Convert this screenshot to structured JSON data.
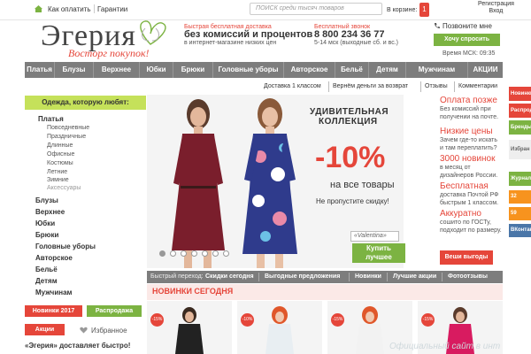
{
  "topbar": {
    "how_to_pay": "Как оплатить",
    "guarantee": "Гарантии",
    "search_placeholder": "ПОИСК среди тысяч товаров",
    "cart_label": "В корзине:",
    "cart_count": "1",
    "register": "Регистрация",
    "login": "Вход"
  },
  "header": {
    "logo": "Эгерия",
    "slogan": "Восторг покупок!",
    "delivery_line1": "Быстрая бесплатная доставка",
    "delivery_line2": "без комиссий и процентов",
    "delivery_line3": "в интернет-магазине низких цен",
    "call_line1": "Бесплатный звонок",
    "phone": "8 800 234 36 77",
    "hours": "5-14 мск (выходные сб. и вс.)",
    "call_me": "Позвоните мне",
    "ask_button": "Хочу спросить",
    "msk_time": "Время МСК: 09:35"
  },
  "nav": {
    "items": [
      "Платья",
      "Блузы",
      "Верхнее",
      "Юбки",
      "Брюки",
      "Головные уборы",
      "Авторское",
      "Бельё",
      "Детям",
      "Мужчинам",
      "АКЦИИ"
    ]
  },
  "subnav": {
    "items": [
      "Доставка 1 классом",
      "Вернём деньги за возврат",
      "Отзывы",
      "Комментарии"
    ]
  },
  "sidebar": {
    "heading": "Одежда, которую любят:",
    "dresses": "Платья",
    "dress_sub": [
      "Повседневные",
      "Праздничные",
      "Длинные",
      "Офисные",
      "Костюмы",
      "Летние",
      "Зимние",
      "Аксессуары"
    ],
    "categories": [
      "Блузы",
      "Верхнее",
      "Юбки",
      "Брюки",
      "Головные уборы",
      "Авторское",
      "Бельё",
      "Детям",
      "Мужчинам"
    ],
    "new_2017": "Новинки 2017",
    "sale": "Распродажа",
    "actions": "Акции",
    "favorites": "Избранное",
    "promo_bold": "«Эгерия» доставляет быстро!"
  },
  "banner": {
    "heading_line1": "УДИВИТЕЛЬНАЯ",
    "heading_line2": "КОЛЛЕКЦИЯ",
    "discount": "-10%",
    "on_all": "на все товары",
    "dont_miss": "Не пропустите скидку!",
    "search_value": "«Valentina»",
    "buy_line1": "Купить",
    "buy_line2": "лучшее"
  },
  "right_promo": {
    "pay_title": "Оплата позже",
    "pay_text": [
      "Без комиссий при",
      "получении на почте."
    ],
    "low_title": "Низкие цены",
    "low_text": [
      "Зачем где-то искать",
      "и там переплатить?"
    ],
    "new_title": "3000 новинок",
    "new_text": [
      "в месяц от",
      "дизайнеров России."
    ],
    "free_title": "Бесплатная",
    "free_text": [
      "доставка Почтой РФ",
      "быстрым 1 классом."
    ],
    "neat_title": "Аккуратно",
    "neat_text": [
      "сошито по ГОСТу,",
      "подходит по размеру."
    ],
    "size_button": "Веши выгоды"
  },
  "quick_nav": {
    "label": "Быстрый переход:",
    "items": [
      "Скидки сегодня",
      "Выгодные предложения",
      "Новинки",
      "Лучшие акции",
      "Фотоотзывы"
    ]
  },
  "news": {
    "title": "НОВИНКИ СЕГОДНЯ",
    "badges": [
      "-15%",
      "-10%",
      "-15%",
      "-15%"
    ]
  },
  "edge": {
    "items": [
      "Новинки",
      "Распрод",
      "Бренды",
      "Избран",
      "Журнал",
      "32",
      "59",
      "ВКонтакте"
    ]
  },
  "watermark": "Официальный сайт в инт",
  "colors": {
    "accent_red": "#e5463a",
    "accent_green": "#7cb342",
    "nav_gray": "#7d7d7d",
    "lime": "#c5e15a"
  }
}
